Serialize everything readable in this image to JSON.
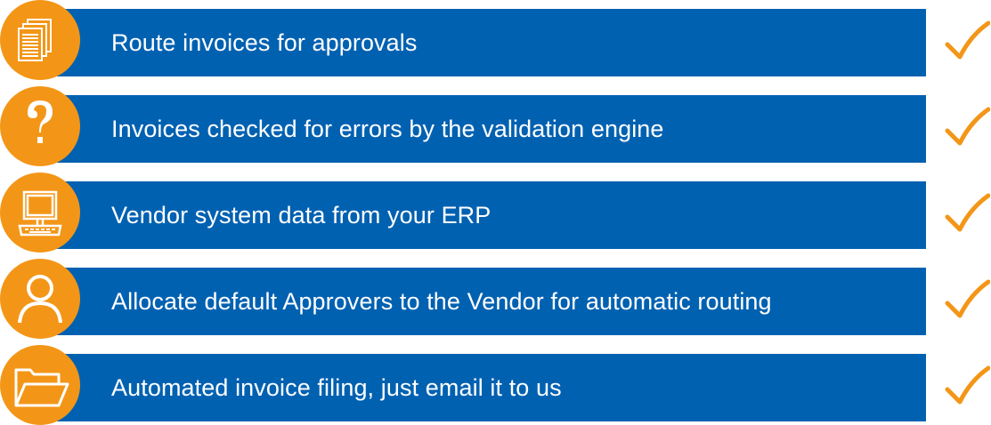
{
  "colors": {
    "bar": "#0161B1",
    "icon_circle": "#F39617",
    "check": "#F39617",
    "text": "#FFFFFF"
  },
  "items": [
    {
      "label": "Route invoices for approvals",
      "icon": "documents-icon",
      "checked": true
    },
    {
      "label": "Invoices checked for errors by the validation engine",
      "icon": "question-icon",
      "checked": true
    },
    {
      "label": "Vendor system data from your ERP",
      "icon": "computer-icon",
      "checked": true
    },
    {
      "label": "Allocate default Approvers to the Vendor for automatic routing",
      "icon": "user-icon",
      "checked": true
    },
    {
      "label": "Automated invoice filing, just email it to us",
      "icon": "folder-icon",
      "checked": true
    }
  ]
}
